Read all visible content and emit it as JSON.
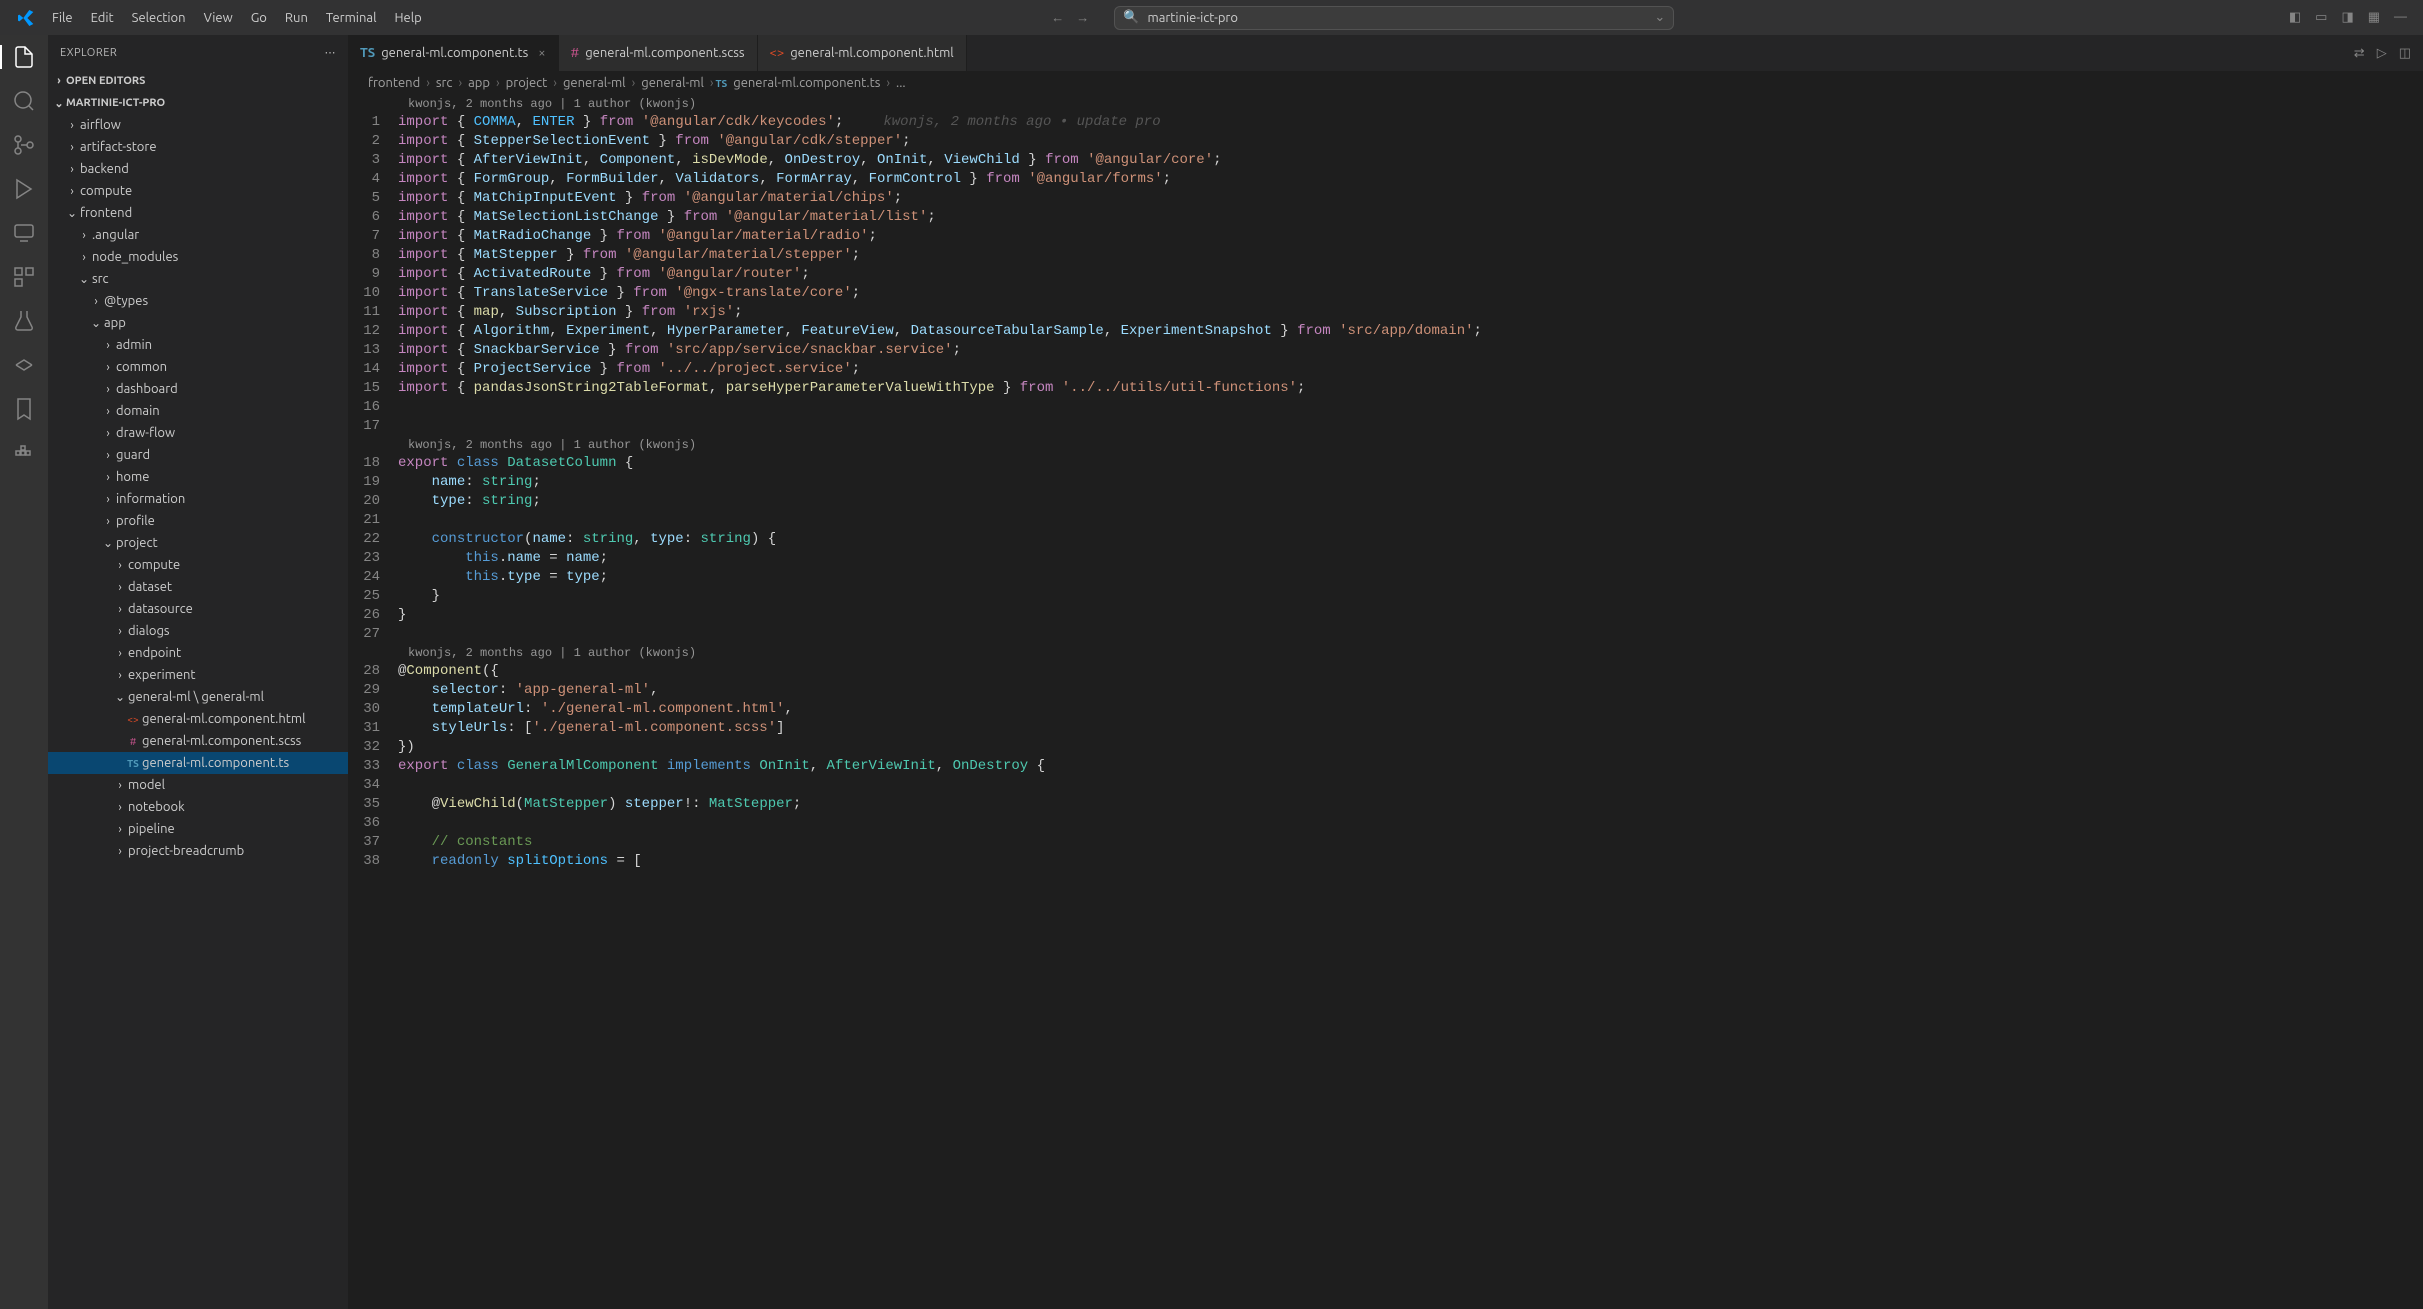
{
  "menu": [
    "File",
    "Edit",
    "Selection",
    "View",
    "Go",
    "Run",
    "Terminal",
    "Help"
  ],
  "search": {
    "placeholder": "martinie-ict-pro"
  },
  "sidebar": {
    "title": "EXPLORER",
    "openEditors": "OPEN EDITORS",
    "project": "MARTINIE-ICT-PRO",
    "tree": [
      {
        "l": "airflow",
        "i": 1,
        "c": false
      },
      {
        "l": "artifact-store",
        "i": 1,
        "c": false
      },
      {
        "l": "backend",
        "i": 1,
        "c": false
      },
      {
        "l": "compute",
        "i": 1,
        "c": false
      },
      {
        "l": "frontend",
        "i": 1,
        "c": true
      },
      {
        "l": ".angular",
        "i": 2,
        "c": false
      },
      {
        "l": "node_modules",
        "i": 2,
        "c": false
      },
      {
        "l": "src",
        "i": 2,
        "c": true
      },
      {
        "l": "@types",
        "i": 3,
        "c": false
      },
      {
        "l": "app",
        "i": 3,
        "c": true
      },
      {
        "l": "admin",
        "i": 4,
        "c": false
      },
      {
        "l": "common",
        "i": 4,
        "c": false
      },
      {
        "l": "dashboard",
        "i": 4,
        "c": false
      },
      {
        "l": "domain",
        "i": 4,
        "c": false
      },
      {
        "l": "draw-flow",
        "i": 4,
        "c": false
      },
      {
        "l": "guard",
        "i": 4,
        "c": false
      },
      {
        "l": "home",
        "i": 4,
        "c": false
      },
      {
        "l": "information",
        "i": 4,
        "c": false
      },
      {
        "l": "profile",
        "i": 4,
        "c": false
      },
      {
        "l": "project",
        "i": 4,
        "c": true
      },
      {
        "l": "compute",
        "i": 5,
        "c": false
      },
      {
        "l": "dataset",
        "i": 5,
        "c": false
      },
      {
        "l": "datasource",
        "i": 5,
        "c": false
      },
      {
        "l": "dialogs",
        "i": 5,
        "c": false
      },
      {
        "l": "endpoint",
        "i": 5,
        "c": false
      },
      {
        "l": "experiment",
        "i": 5,
        "c": false
      },
      {
        "l": "general-ml \\ general-ml",
        "i": 5,
        "c": true
      },
      {
        "l": "general-ml.component.html",
        "i": 6,
        "f": "html"
      },
      {
        "l": "general-ml.component.scss",
        "i": 6,
        "f": "scss"
      },
      {
        "l": "general-ml.component.ts",
        "i": 6,
        "f": "ts",
        "sel": true
      },
      {
        "l": "model",
        "i": 5,
        "c": false
      },
      {
        "l": "notebook",
        "i": 5,
        "c": false
      },
      {
        "l": "pipeline",
        "i": 5,
        "c": false
      },
      {
        "l": "project-breadcrumb",
        "i": 5,
        "c": false
      }
    ]
  },
  "tabs": [
    {
      "label": "general-ml.component.ts",
      "icon": "ts",
      "active": true,
      "close": true
    },
    {
      "label": "general-ml.component.scss",
      "icon": "scss"
    },
    {
      "label": "general-ml.component.html",
      "icon": "html"
    }
  ],
  "breadcrumbs": [
    "frontend",
    "src",
    "app",
    "project",
    "general-ml",
    "general-ml",
    "general-ml.component.ts",
    "..."
  ],
  "codelens": "kwonjs, 2 months ago | 1 author (kwonjs)",
  "codelens2": "kwonjs, 2 months ago | 1 author (kwonjs)",
  "codelens3": "kwonjs, 2 months ago | 1 author (kwonjs)",
  "blame1": "kwonjs, 2 months ago • update pro",
  "code": {
    "l1a": "import",
    "l1b": "COMMA",
    "l1c": "ENTER",
    "l1d": "from",
    "l1e": "'@angular/cdk/keycodes'",
    "l2a": "StepperSelectionEvent",
    "l2b": "'@angular/cdk/stepper'",
    "l3a": "AfterViewInit",
    "l3b": "Component",
    "l3c": "isDevMode",
    "l3d": "OnDestroy",
    "l3e": "OnInit",
    "l3f": "ViewChild",
    "l3g": "'@angular/core'",
    "l4a": "FormGroup",
    "l4b": "FormBuilder",
    "l4c": "Validators",
    "l4d": "FormArray",
    "l4e": "FormControl",
    "l4f": "'@angular/forms'",
    "l5a": "MatChipInputEvent",
    "l5b": "'@angular/material/chips'",
    "l6a": "MatSelectionListChange",
    "l6b": "'@angular/material/list'",
    "l7a": "MatRadioChange",
    "l7b": "'@angular/material/radio'",
    "l8a": "MatStepper",
    "l8b": "'@angular/material/stepper'",
    "l9a": "ActivatedRoute",
    "l9b": "'@angular/router'",
    "l10a": "TranslateService",
    "l10b": "'@ngx-translate/core'",
    "l11a": "map",
    "l11b": "Subscription",
    "l11c": "'rxjs'",
    "l12a": "Algorithm",
    "l12b": "Experiment",
    "l12c": "HyperParameter",
    "l12d": "FeatureView",
    "l12e": "DatasourceTabularSample",
    "l12f": "ExperimentSnapshot",
    "l12g": "'src/app/domain'",
    "l13a": "SnackbarService",
    "l13b": "'src/app/service/snackbar.service'",
    "l14a": "ProjectService",
    "l14b": "'../../project.service'",
    "l15a": "pandasJsonString2TableFormat",
    "l15b": "parseHyperParameterValueWithType",
    "l15c": "'../../utils/util-functions'",
    "l18a": "export",
    "l18b": "class",
    "l18c": "DatasetColumn",
    "l19a": "name",
    "l19b": "string",
    "l20a": "type",
    "l20b": "string",
    "l22a": "constructor",
    "l22b": "name",
    "l22c": "string",
    "l22d": "type",
    "l22e": "string",
    "l23a": "this",
    "l23b": "name",
    "l23c": "name",
    "l24a": "this",
    "l24b": "type",
    "l24c": "type",
    "l28a": "Component",
    "l29a": "selector",
    "l29b": "'app-general-ml'",
    "l30a": "templateUrl",
    "l30b": "'./general-ml.component.html'",
    "l31a": "styleUrls",
    "l31b": "'./general-ml.component.scss'",
    "l33a": "export",
    "l33b": "class",
    "l33c": "GeneralMlComponent",
    "l33d": "implements",
    "l33e": "OnInit",
    "l33f": "AfterViewInit",
    "l33g": "OnDestroy",
    "l35a": "ViewChild",
    "l35b": "MatStepper",
    "l35c": "stepper",
    "l35d": "MatStepper",
    "l37a": "// constants",
    "l38a": "readonly",
    "l38b": "splitOptions"
  }
}
